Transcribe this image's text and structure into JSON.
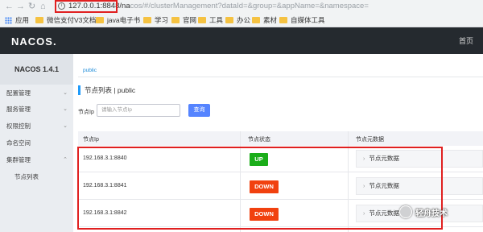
{
  "browser": {
    "back_icon": "arrow-left",
    "forward_icon": "arrow-right",
    "reload_icon": "reload",
    "home_icon": "home",
    "url_host": "127.0.0.1:8848/na",
    "url_rest": "cos/#/clusterManagement?dataId=&group=&appName=&namespace="
  },
  "bookmarks": [
    {
      "label": "应用",
      "icon": "apps-grid"
    },
    {
      "label": "微信支付V3文档",
      "icon": "folder"
    },
    {
      "label": "java电子书",
      "icon": "folder"
    },
    {
      "label": "学习",
      "icon": "folder"
    },
    {
      "label": "官网",
      "icon": "folder"
    },
    {
      "label": "工具",
      "icon": "folder"
    },
    {
      "label": "办公",
      "icon": "folder"
    },
    {
      "label": "素材",
      "icon": "folder"
    },
    {
      "label": "自媒体工具",
      "icon": "folder"
    }
  ],
  "header": {
    "logo": "NACOS.",
    "home_link": "首页"
  },
  "sidebar": {
    "version": "NACOS 1.4.1",
    "items": [
      {
        "label": "配置管理",
        "expandable": true
      },
      {
        "label": "服务管理",
        "expandable": true
      },
      {
        "label": "权限控制",
        "expandable": true
      },
      {
        "label": "命名空间",
        "expandable": false
      },
      {
        "label": "集群管理",
        "expandable": true
      },
      {
        "label": "节点列表",
        "expandable": false
      }
    ]
  },
  "main": {
    "namespace_crumb": "public",
    "title": "节点列表  |  public",
    "filter": {
      "label": "节点Ip",
      "placeholder": "请输入节点Ip",
      "query_button": "查询"
    },
    "table": {
      "headers": [
        "节点Ip",
        "节点状态",
        "节点元数据"
      ],
      "rows": [
        {
          "ip": "192.168.3.1:8840",
          "status": "UP",
          "meta": "节点元数据"
        },
        {
          "ip": "192.168.3.1:8841",
          "status": "DOWN",
          "meta": "节点元数据"
        },
        {
          "ip": "192.168.3.1:8842",
          "status": "DOWN",
          "meta": "节点元数据"
        }
      ]
    }
  },
  "colors": {
    "status_up": "#1aad19",
    "status_down": "#f1410f",
    "accent": "#5584ff",
    "highlight_box": "#e02020"
  },
  "watermark": "轻舟技术"
}
